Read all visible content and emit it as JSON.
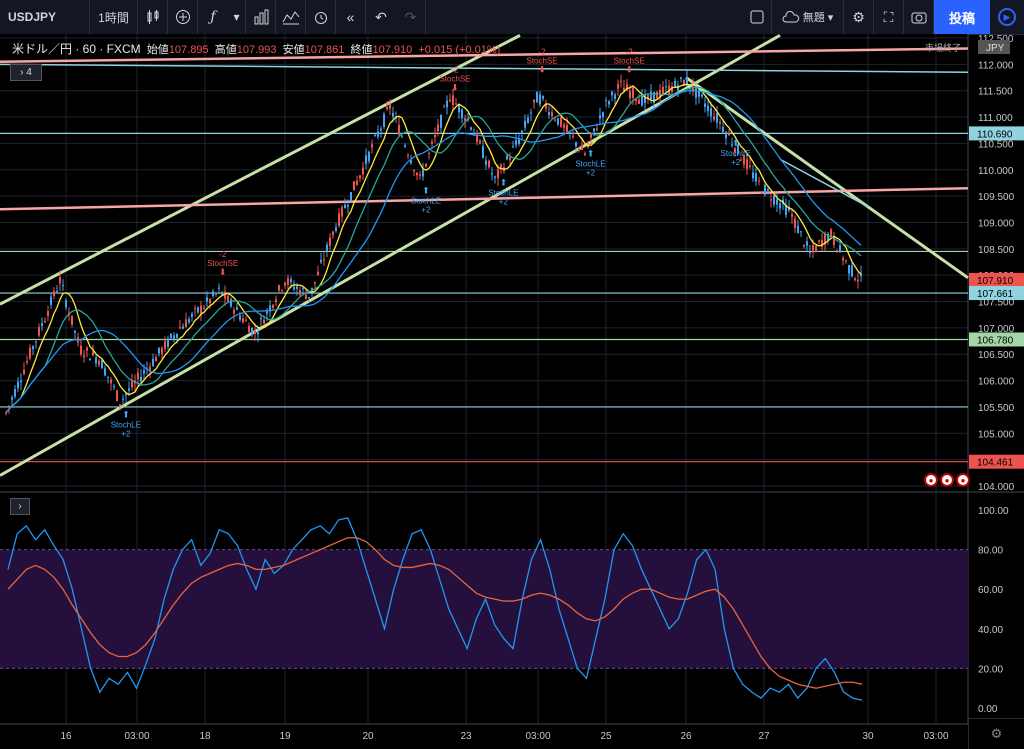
{
  "toolbar": {
    "symbol": "USDJPY",
    "interval": "1時間",
    "layout_name": "無題",
    "publish_label": "投稿",
    "icons": [
      "candles-icon",
      "plus-circle-icon",
      "fx-icon",
      "chevron-down-icon",
      "bar-chart-icon",
      "template-icon",
      "alarm-icon",
      "rewind-icon",
      "undo-icon",
      "redo-icon",
      "square-icon",
      "cloud-icon",
      "chevron-down-icon",
      "gear-icon",
      "fullscreen-icon",
      "camera-icon",
      "play-icon"
    ]
  },
  "legend": {
    "pair": "米ドル／円 · 60 · FXCM",
    "open_label": "始値",
    "open": "107.895",
    "high_label": "高値",
    "high": "107.993",
    "low_label": "安値",
    "low": "107.861",
    "close_label": "終値",
    "close": "107.910",
    "change": "+0.015 (+0.01%)",
    "collapse": "4"
  },
  "currency_label": "JPY",
  "market_status": "市場終了",
  "chart_data": [
    {
      "type": "candlestick",
      "price_axis": [
        "112.500",
        "112.000",
        "111.500",
        "111.000",
        "110.500",
        "110.000",
        "109.500",
        "109.000",
        "108.500",
        "108.000",
        "107.500",
        "107.000",
        "106.500",
        "106.000",
        "105.500",
        "105.000",
        "104.500",
        "104.000"
      ],
      "ylim": [
        104.0,
        112.5
      ],
      "time_axis": [
        "16",
        "03:00",
        "18",
        "19",
        "20",
        "23",
        "03:00",
        "25",
        "26",
        "27",
        "30",
        "03:00"
      ],
      "price_badges": [
        {
          "value": "110.690",
          "color": "#8fd3e0"
        },
        {
          "value": "107.910",
          "color": "#ef5350"
        },
        {
          "value": "107.661",
          "color": "#8fd3e0"
        },
        {
          "value": "106.780",
          "color": "#a5d6a7"
        },
        {
          "value": "104.461",
          "color": "#ef5350"
        }
      ],
      "horizontal_levels": [
        {
          "y": 110.69,
          "color": "#8fd3e0"
        },
        {
          "y": 108.45,
          "color": "#a5d6a7"
        },
        {
          "y": 107.661,
          "color": "#8fd3e0"
        },
        {
          "y": 106.78,
          "color": "#a5d6a7"
        },
        {
          "y": 105.5,
          "color": "#8fd3e0"
        },
        {
          "y": 104.461,
          "color": "#ef5350"
        }
      ],
      "signals": [
        {
          "label": "StochLE",
          "sub": "+2",
          "type": "long",
          "x": 0.13,
          "y": 105.3
        },
        {
          "label": "StochSE",
          "sub": "-2",
          "type": "short",
          "x": 0.23,
          "y": 108.0
        },
        {
          "label": "StochSE",
          "sub": "-2",
          "type": "short",
          "x": 0.47,
          "y": 111.5
        },
        {
          "label": "StochLE",
          "sub": "+2",
          "type": "long",
          "x": 0.44,
          "y": 109.55
        },
        {
          "label": "StochLE",
          "sub": "+2",
          "type": "long",
          "x": 0.52,
          "y": 109.7
        },
        {
          "label": "StochSE",
          "sub": "-2",
          "type": "short",
          "x": 0.56,
          "y": 111.85
        },
        {
          "label": "StochLE",
          "sub": "+2",
          "type": "long",
          "x": 0.61,
          "y": 110.25
        },
        {
          "label": "StochSE",
          "sub": "-2",
          "type": "short",
          "x": 0.65,
          "y": 111.85
        },
        {
          "label": "StochLE",
          "sub": "+2",
          "type": "long",
          "x": 0.76,
          "y": 110.45
        }
      ],
      "colors": {
        "up": "#ef5350",
        "down": "#42a5f5",
        "ma_fast": "#ffeb3b",
        "ma_mid": "#26a69a",
        "ma_slow": "#2196f3"
      }
    },
    {
      "type": "line",
      "title": "",
      "ylabel_ticks": [
        "100.00",
        "80.00",
        "60.00",
        "40.00",
        "20.00",
        "0.00"
      ],
      "ylim": [
        0,
        100
      ],
      "band": [
        20,
        80
      ],
      "series": [
        {
          "color": "#2196f3",
          "values": [
            70,
            88,
            92,
            85,
            90,
            82,
            75,
            60,
            40,
            20,
            8,
            15,
            12,
            18,
            10,
            22,
            35,
            55,
            70,
            80,
            85,
            72,
            78,
            90,
            88,
            82,
            70,
            60,
            75,
            68,
            72,
            80,
            85,
            90,
            92,
            88,
            95,
            96,
            85,
            70,
            55,
            40,
            60,
            75,
            88,
            90,
            80,
            65,
            50,
            40,
            30,
            45,
            55,
            42,
            35,
            30,
            55,
            75,
            85,
            70,
            50,
            35,
            20,
            15,
            35,
            55,
            80,
            88,
            82,
            70,
            60,
            50,
            40,
            45,
            58,
            75,
            80,
            70,
            40,
            20,
            12,
            8,
            5,
            10,
            8,
            12,
            5,
            10,
            20,
            25,
            18,
            8,
            5,
            4
          ]
        },
        {
          "color": "#e8643c",
          "values": [
            60,
            65,
            70,
            72,
            70,
            66,
            60,
            52,
            45,
            38,
            32,
            28,
            26,
            26,
            28,
            32,
            38,
            45,
            52,
            58,
            63,
            66,
            68,
            70,
            72,
            73,
            72,
            70,
            70,
            71,
            72,
            74,
            76,
            78,
            80,
            82,
            84,
            86,
            86,
            84,
            80,
            75,
            72,
            71,
            71,
            72,
            73,
            72,
            70,
            66,
            62,
            58,
            56,
            55,
            54,
            54,
            55,
            57,
            58,
            57,
            55,
            52,
            48,
            45,
            44,
            46,
            50,
            55,
            58,
            60,
            60,
            58,
            56,
            55,
            55,
            57,
            59,
            60,
            56,
            50,
            42,
            34,
            26,
            20,
            16,
            14,
            12,
            11,
            10,
            11,
            12,
            13,
            13,
            12
          ]
        }
      ]
    }
  ]
}
